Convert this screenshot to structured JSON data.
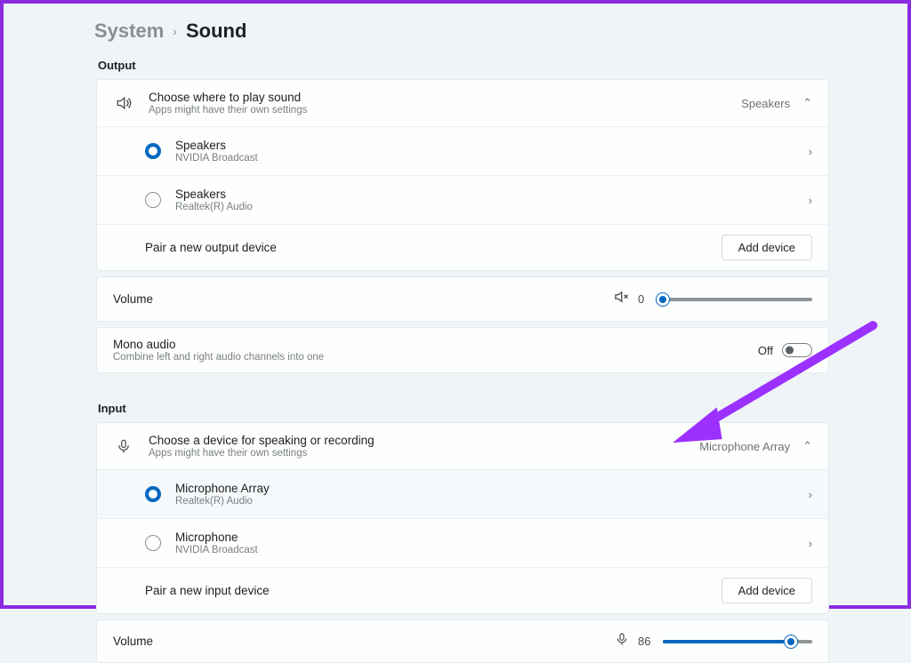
{
  "breadcrumb": {
    "parent": "System",
    "current": "Sound"
  },
  "output": {
    "section": "Output",
    "header": {
      "title": "Choose where to play sound",
      "subtitle": "Apps might have their own settings",
      "summary": "Speakers"
    },
    "devices": [
      {
        "name": "Speakers",
        "provider": "NVIDIA Broadcast",
        "selected": true
      },
      {
        "name": "Speakers",
        "provider": "Realtek(R) Audio",
        "selected": false
      }
    ],
    "pair": "Pair a new output device",
    "add": "Add device",
    "volume_label": "Volume",
    "volume_value": "0",
    "mono": {
      "title": "Mono audio",
      "subtitle": "Combine left and right audio channels into one",
      "state": "Off"
    }
  },
  "input": {
    "section": "Input",
    "header": {
      "title": "Choose a device for speaking or recording",
      "subtitle": "Apps might have their own settings",
      "summary": "Microphone Array"
    },
    "devices": [
      {
        "name": "Microphone Array",
        "provider": "Realtek(R) Audio",
        "selected": true
      },
      {
        "name": "Microphone",
        "provider": "NVIDIA Broadcast",
        "selected": false
      }
    ],
    "pair": "Pair a new input device",
    "add": "Add device",
    "volume_label": "Volume",
    "volume_value": "86"
  }
}
